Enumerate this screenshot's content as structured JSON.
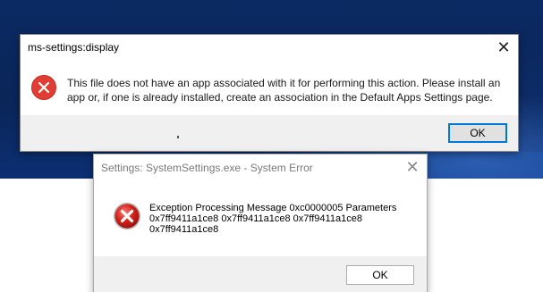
{
  "dialog1": {
    "title": "ms-settings:display",
    "close_glyph": "✕",
    "icon": "error-circle-icon",
    "message": "This file does not have an app associated with it for performing this action. Please install an app or, if one is already installed, create an association in the Default Apps Settings page.",
    "ok_label": "OK"
  },
  "dialog2": {
    "title": "Settings: SystemSettings.exe - System Error",
    "close_glyph": "✕",
    "icon": "error-x-icon",
    "message_lines": [
      "Exception Processing Message 0xc0000005 Parameters",
      "0x7ff9411a1ce8 0x7ff9411a1ce8 0x7ff9411a1ce8",
      "0x7ff9411a1ce8"
    ],
    "ok_label": "OK"
  },
  "colors": {
    "error_red": "#e23d33",
    "focus_blue": "#0078d7",
    "desktop_blue": "#0b2a63"
  }
}
